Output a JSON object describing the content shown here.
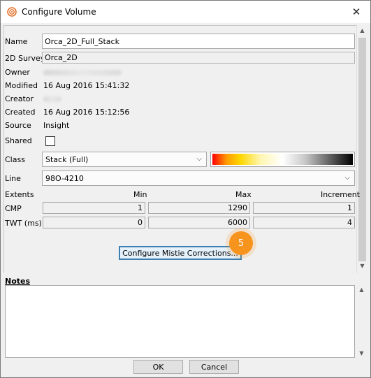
{
  "window": {
    "title": "Configure Volume",
    "close_glyph": "✕"
  },
  "fields": {
    "name": {
      "label": "Name",
      "value": "Orca_2D_Full_Stack"
    },
    "survey": {
      "label": "2D Survey",
      "value": "Orca_2D"
    },
    "owner": {
      "label": "Owner"
    },
    "modified": {
      "label": "Modified",
      "value": "16 Aug 2016 15:41:32"
    },
    "creator": {
      "label": "Creator"
    },
    "created": {
      "label": "Created",
      "value": "16 Aug 2016 15:12:56"
    },
    "source": {
      "label": "Source",
      "value": "Insight"
    },
    "shared": {
      "label": "Shared",
      "checked": false
    },
    "class": {
      "label": "Class",
      "value": "Stack (Full)"
    },
    "line": {
      "label": "Line",
      "value": "98O-4210"
    }
  },
  "extents": {
    "label": "Extents",
    "headers": [
      "Min",
      "Max",
      "Increment"
    ],
    "rows": [
      {
        "label": "CMP",
        "min": "1",
        "max": "1290",
        "increment": "1"
      },
      {
        "label": "TWT (ms)",
        "min": "0",
        "max": "6000",
        "increment": "4"
      }
    ]
  },
  "mistie_button": "Configure Mistie Corrections...",
  "step_badge": "5",
  "notes": {
    "label": "Notes",
    "value": ""
  },
  "footer": {
    "ok": "OK",
    "cancel": "Cancel"
  },
  "icons": {
    "app": "seismic-logo-icon",
    "chevron": "chevron-down-icon",
    "close": "close-icon"
  },
  "colors": {
    "accent_badge": "#f7941d",
    "logo": "#e4712a",
    "colorbar": [
      "#ff0000",
      "#ffd700",
      "#ffffff",
      "#000000"
    ]
  }
}
